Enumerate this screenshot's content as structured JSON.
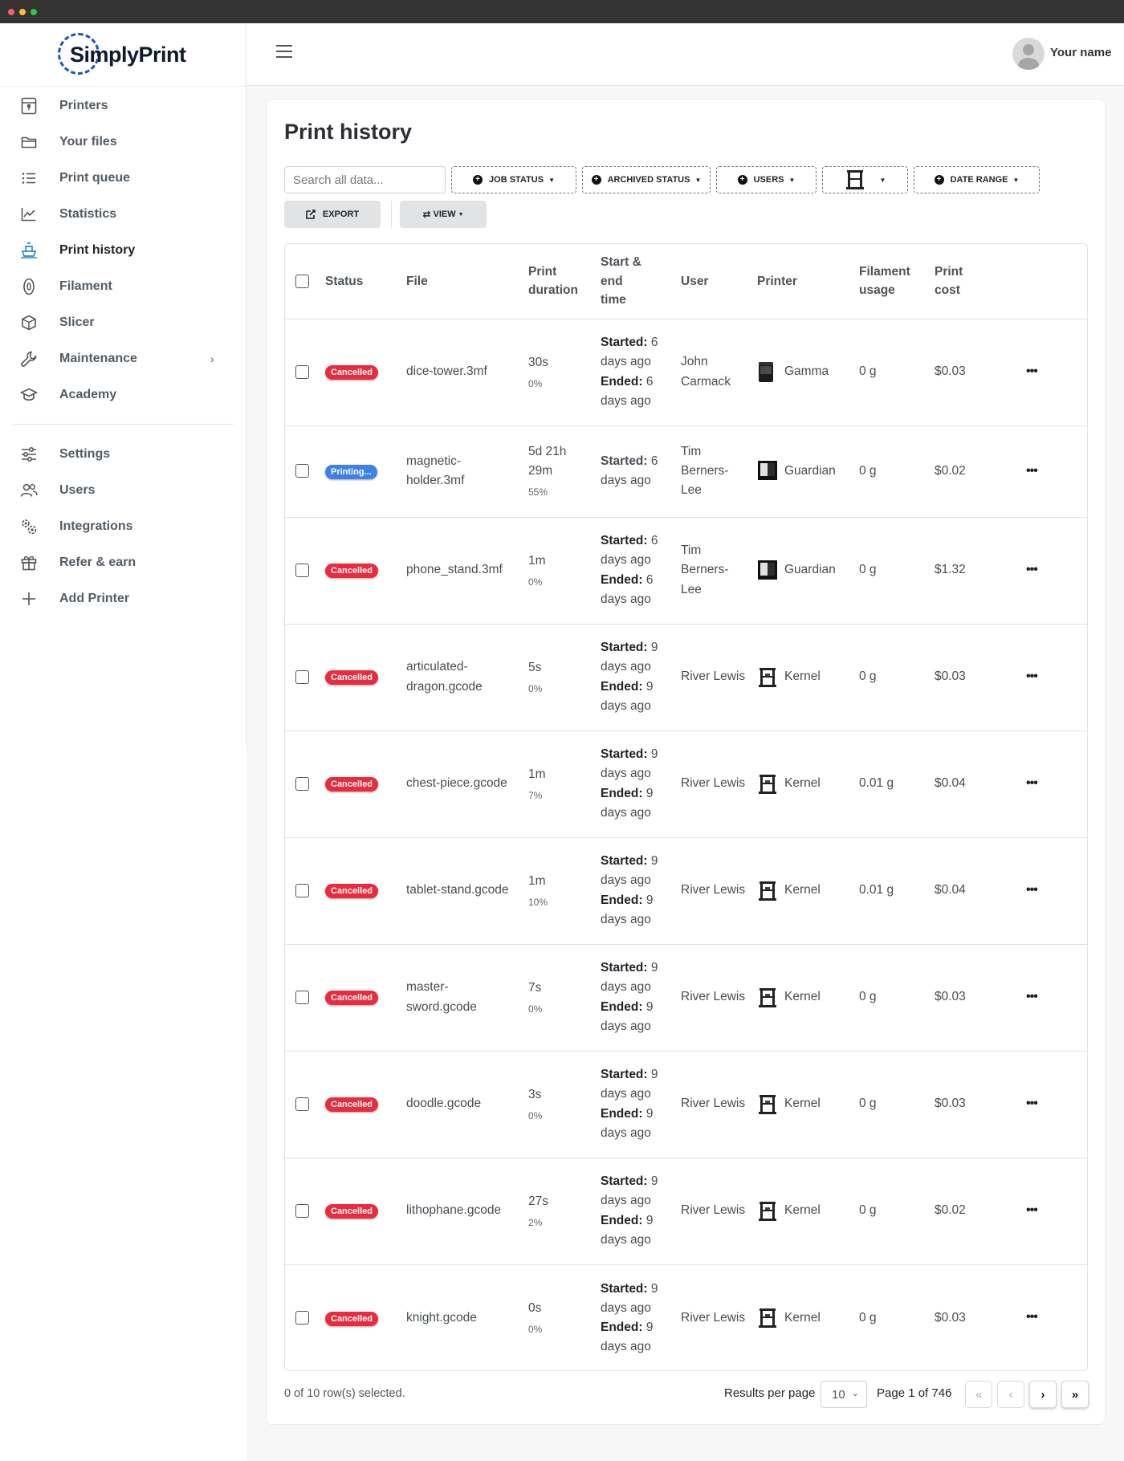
{
  "app": {
    "brand": "SimplyPrint"
  },
  "sidebar": {
    "items": [
      {
        "label": "Printers",
        "icon": "printer-icon"
      },
      {
        "label": "Your files",
        "icon": "folder-icon"
      },
      {
        "label": "Print queue",
        "icon": "list-icon"
      },
      {
        "label": "Statistics",
        "icon": "chart-icon"
      },
      {
        "label": "Print history",
        "icon": "history-icon",
        "active": true
      },
      {
        "label": "Filament",
        "icon": "filament-spool-icon"
      },
      {
        "label": "Slicer",
        "icon": "cube-icon"
      },
      {
        "label": "Maintenance",
        "icon": "wrench-icon",
        "chevron": "›"
      },
      {
        "label": "Academy",
        "icon": "graduation-cap-icon"
      }
    ],
    "bottom_items": [
      {
        "label": "Settings",
        "icon": "sliders-icon"
      },
      {
        "label": "Users",
        "icon": "users-icon"
      },
      {
        "label": "Integrations",
        "icon": "gears-icon"
      },
      {
        "label": "Refer & earn",
        "icon": "gift-icon"
      },
      {
        "label": "Add Printer",
        "icon": "plus-icon"
      }
    ]
  },
  "topbar": {
    "user_name": "Your name"
  },
  "page": {
    "title": "Print history",
    "search_placeholder": "Search all data...",
    "filters": {
      "job_status": "JOB STATUS",
      "archived_status": "ARCHIVED STATUS",
      "users": "USERS",
      "date_range": "DATE RANGE"
    },
    "export_label": "EXPORT",
    "view_label": "VIEW"
  },
  "table": {
    "headers": {
      "status": "Status",
      "file": "File",
      "print_duration": "Print duration",
      "start_end_time": "Start & end time",
      "user": "User",
      "printer": "Printer",
      "filament_usage": "Filament usage",
      "print_cost": "Print cost"
    },
    "started_label": "Started:",
    "ended_label": "Ended:",
    "rows": [
      {
        "status": "Cancelled",
        "file": "dice-tower.3mf",
        "duration": "30s",
        "progress": "0%",
        "started": "6 days ago",
        "ended": "6 days ago",
        "user": "John Carmack",
        "printer": "Gamma",
        "printer_icon": "dark-printer-icon",
        "filament": "0 g",
        "cost": "$0.03"
      },
      {
        "status": "Printing...",
        "file": "magnetic-holder.3mf",
        "duration": "5d 21h 29m",
        "progress": "55%",
        "started": "6 days ago",
        "ended": "",
        "user": "Tim Berners-Lee",
        "printer": "Guardian",
        "printer_icon": "enclosed-printer-icon",
        "filament": "0 g",
        "cost": "$0.02"
      },
      {
        "status": "Cancelled",
        "file": "phone_stand.3mf",
        "duration": "1m",
        "progress": "0%",
        "started": "6 days ago",
        "ended": "6 days ago",
        "user": "Tim Berners-Lee",
        "printer": "Guardian",
        "printer_icon": "enclosed-printer-icon",
        "filament": "0 g",
        "cost": "$1.32"
      },
      {
        "status": "Cancelled",
        "file": "articulated-dragon.gcode",
        "duration": "5s",
        "progress": "0%",
        "started": "9 days ago",
        "ended": "9 days ago",
        "user": "River Lewis",
        "printer": "Kernel",
        "printer_icon": "frame-printer-icon",
        "filament": "0 g",
        "cost": "$0.03"
      },
      {
        "status": "Cancelled",
        "file": "chest-piece.gcode",
        "duration": "1m",
        "progress": "7%",
        "started": "9 days ago",
        "ended": "9 days ago",
        "user": "River Lewis",
        "printer": "Kernel",
        "printer_icon": "frame-printer-icon",
        "filament": "0.01 g",
        "cost": "$0.04"
      },
      {
        "status": "Cancelled",
        "file": "tablet-stand.gcode",
        "duration": "1m",
        "progress": "10%",
        "started": "9 days ago",
        "ended": "9 days ago",
        "user": "River Lewis",
        "printer": "Kernel",
        "printer_icon": "frame-printer-icon",
        "filament": "0.01 g",
        "cost": "$0.04"
      },
      {
        "status": "Cancelled",
        "file": "master-sword.gcode",
        "duration": "7s",
        "progress": "0%",
        "started": "9 days ago",
        "ended": "9 days ago",
        "user": "River Lewis",
        "printer": "Kernel",
        "printer_icon": "frame-printer-icon",
        "filament": "0 g",
        "cost": "$0.03"
      },
      {
        "status": "Cancelled",
        "file": "doodle.gcode",
        "duration": "3s",
        "progress": "0%",
        "started": "9 days ago",
        "ended": "9 days ago",
        "user": "River Lewis",
        "printer": "Kernel",
        "printer_icon": "frame-printer-icon",
        "filament": "0 g",
        "cost": "$0.03"
      },
      {
        "status": "Cancelled",
        "file": "lithophane.gcode",
        "duration": "27s",
        "progress": "2%",
        "started": "9 days ago",
        "ended": "9 days ago",
        "user": "River Lewis",
        "printer": "Kernel",
        "printer_icon": "frame-printer-icon",
        "filament": "0 g",
        "cost": "$0.02"
      },
      {
        "status": "Cancelled",
        "file": "knight.gcode",
        "duration": "0s",
        "progress": "0%",
        "started": "9 days ago",
        "ended": "9 days ago",
        "user": "River Lewis",
        "printer": "Kernel",
        "printer_icon": "frame-printer-icon",
        "filament": "0 g",
        "cost": "$0.03"
      }
    ]
  },
  "footer": {
    "selected_text": "0 of 10 row(s) selected.",
    "results_per_page_label": "Results per page",
    "results_per_page_value": "10",
    "page_text": "Page 1 of 746"
  },
  "colors": {
    "cancelled": "#ea2a3d",
    "printing": "#3e80e8",
    "brand": "#1a55c4"
  }
}
